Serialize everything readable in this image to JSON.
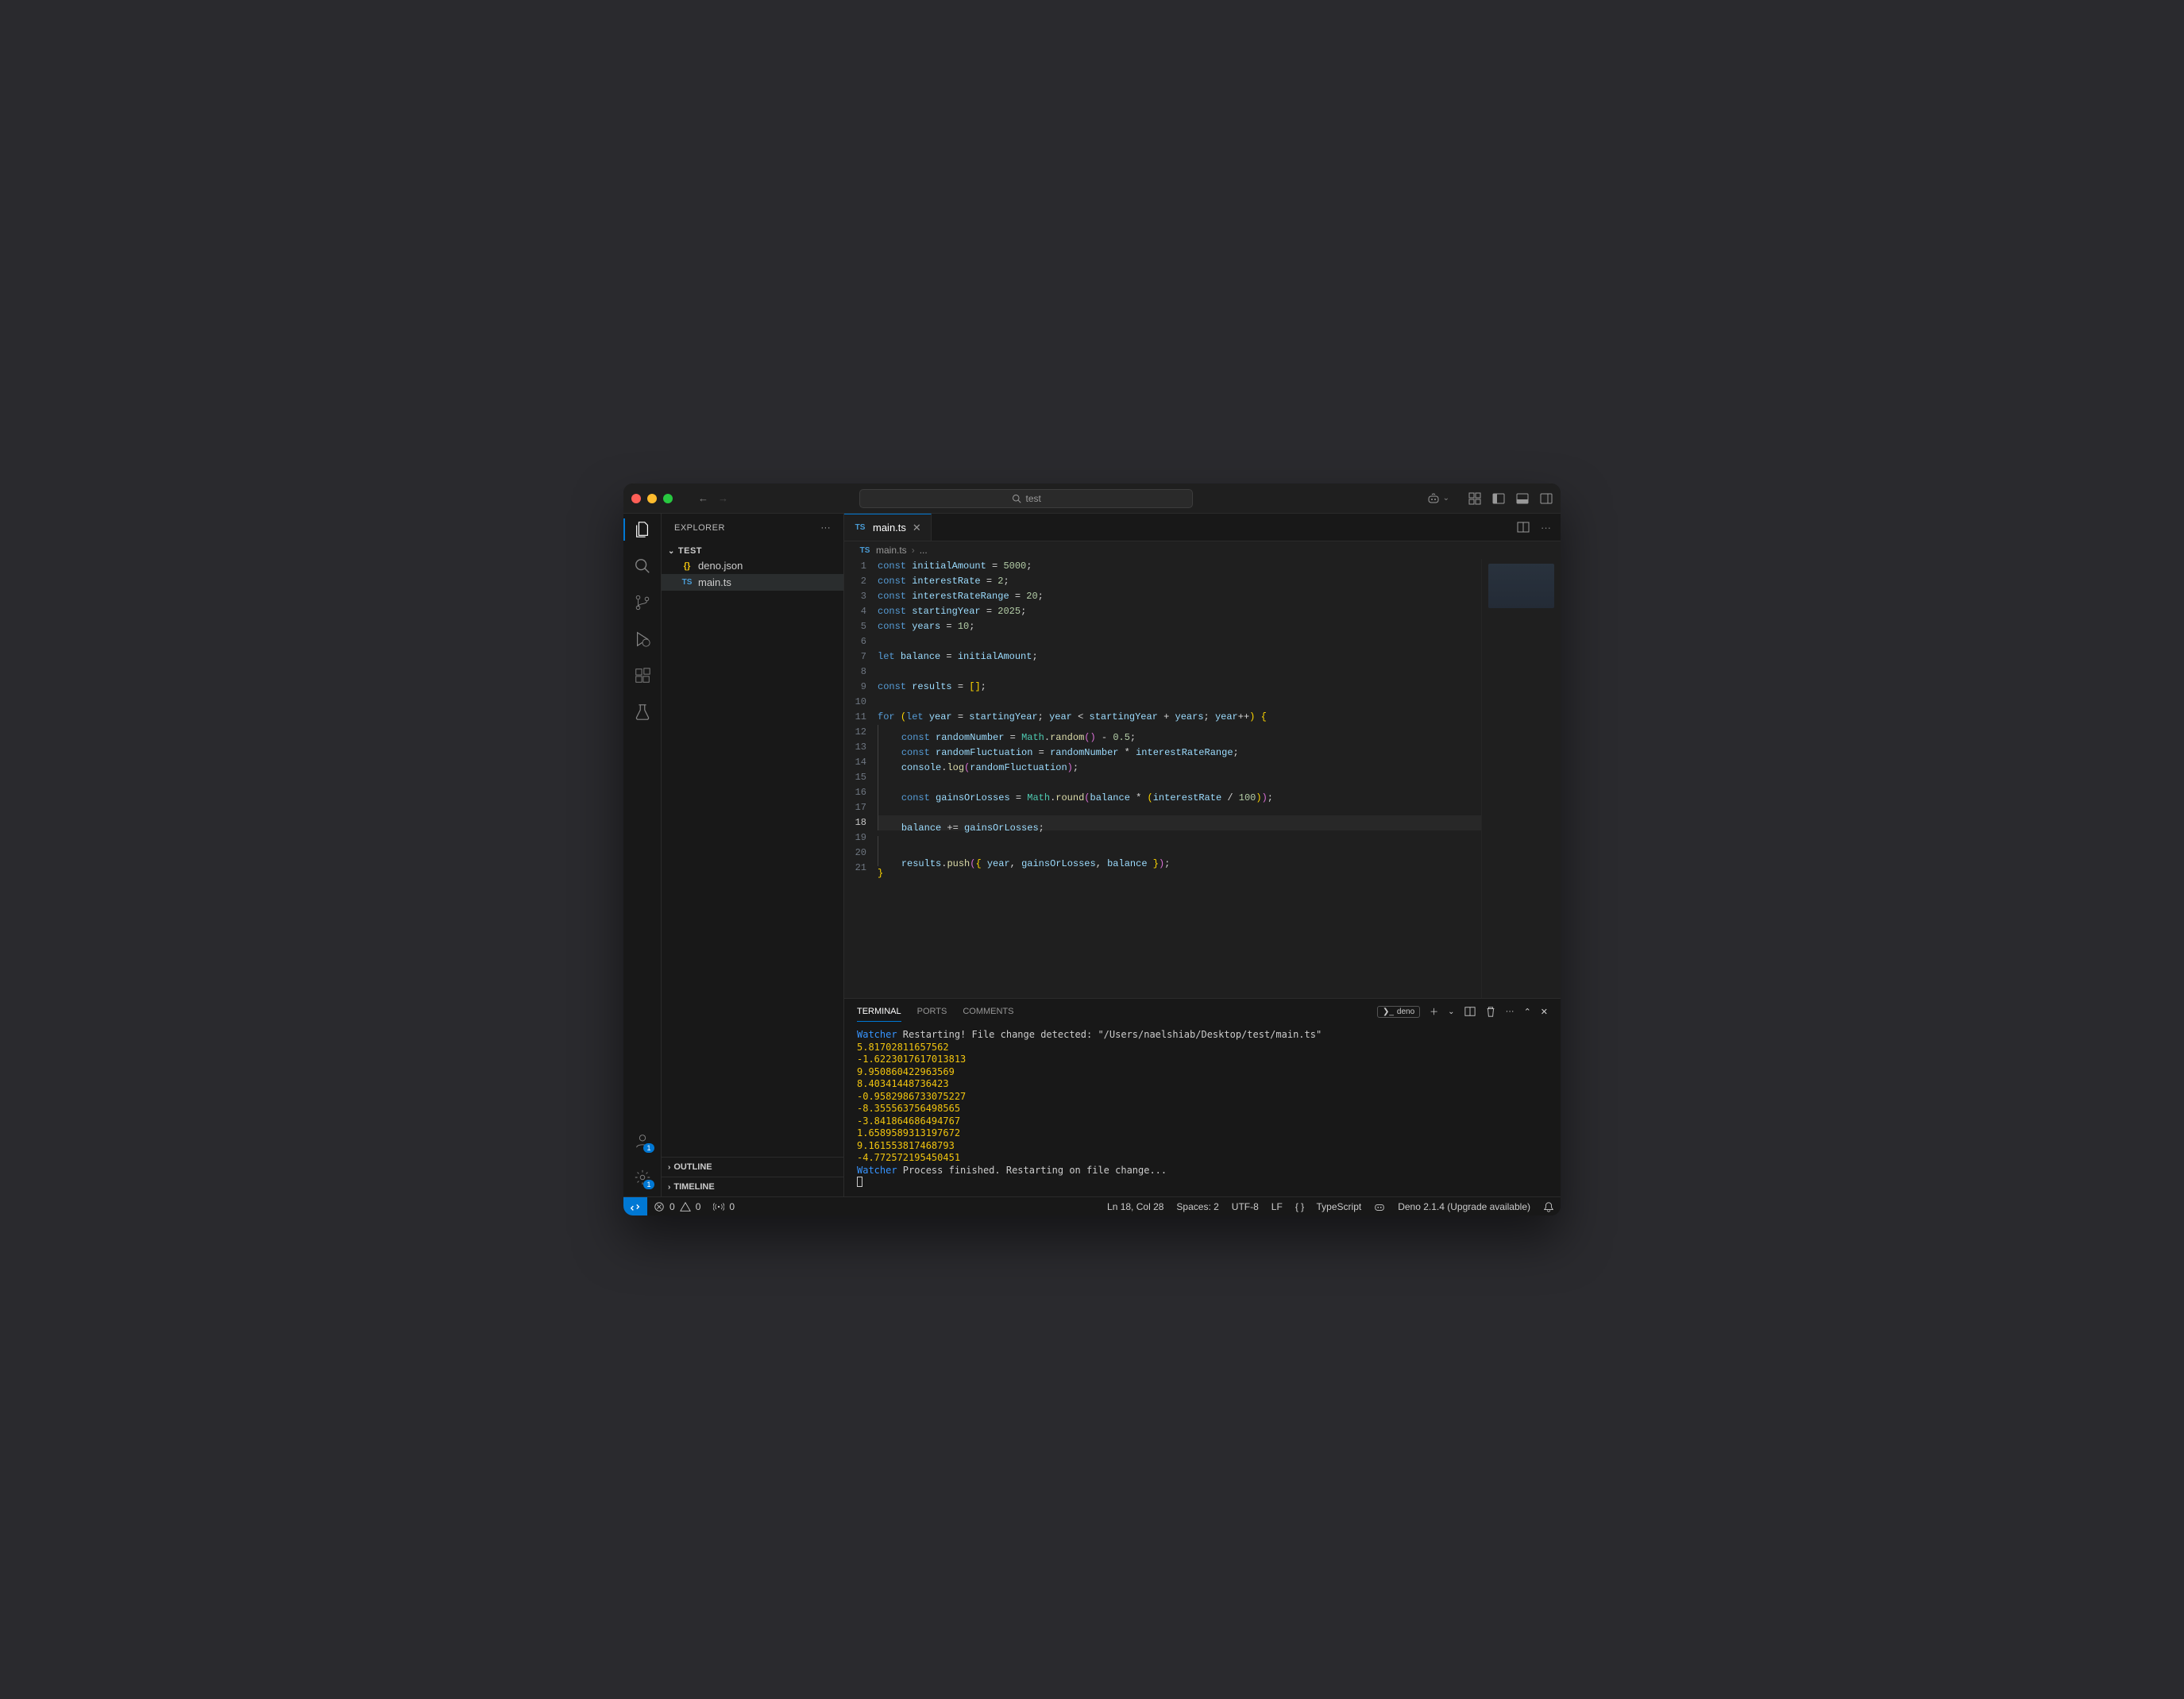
{
  "titlebar": {
    "search_text": "test"
  },
  "sidebar": {
    "title": "EXPLORER",
    "root": "TEST",
    "files": [
      {
        "icon": "{}",
        "icon_class": "json-icon",
        "name": "deno.json",
        "selected": false
      },
      {
        "icon": "TS",
        "icon_class": "ts-icon",
        "name": "main.ts",
        "selected": true
      }
    ],
    "outline": "OUTLINE",
    "timeline": "TIMELINE"
  },
  "activity": {
    "accounts_badge": "1",
    "settings_badge": "1"
  },
  "tab": {
    "icon": "TS",
    "label": "main.ts"
  },
  "breadcrumb": {
    "icon": "TS",
    "file": "main.ts",
    "rest": "..."
  },
  "code": {
    "current_line": 18,
    "lines": [
      [
        [
          "kw",
          "const "
        ],
        [
          "id",
          "initialAmount"
        ],
        [
          "op",
          " = "
        ],
        [
          "nm",
          "5000"
        ],
        [
          "op",
          ";"
        ]
      ],
      [
        [
          "kw",
          "const "
        ],
        [
          "id",
          "interestRate"
        ],
        [
          "op",
          " = "
        ],
        [
          "nm",
          "2"
        ],
        [
          "op",
          ";"
        ]
      ],
      [
        [
          "kw",
          "const "
        ],
        [
          "id",
          "interestRateRange"
        ],
        [
          "op",
          " = "
        ],
        [
          "nm",
          "20"
        ],
        [
          "op",
          ";"
        ]
      ],
      [
        [
          "kw",
          "const "
        ],
        [
          "id",
          "startingYear"
        ],
        [
          "op",
          " = "
        ],
        [
          "nm",
          "2025"
        ],
        [
          "op",
          ";"
        ]
      ],
      [
        [
          "kw",
          "const "
        ],
        [
          "id",
          "years"
        ],
        [
          "op",
          " = "
        ],
        [
          "nm",
          "10"
        ],
        [
          "op",
          ";"
        ]
      ],
      [],
      [
        [
          "kw",
          "let "
        ],
        [
          "id",
          "balance"
        ],
        [
          "op",
          " = "
        ],
        [
          "id",
          "initialAmount"
        ],
        [
          "op",
          ";"
        ]
      ],
      [],
      [
        [
          "kw",
          "const "
        ],
        [
          "id",
          "results"
        ],
        [
          "op",
          " = "
        ],
        [
          "br",
          "["
        ],
        [
          "br",
          "]"
        ],
        [
          "op",
          ";"
        ]
      ],
      [],
      [
        [
          "kw",
          "for "
        ],
        [
          "br",
          "("
        ],
        [
          "kw",
          "let "
        ],
        [
          "id",
          "year"
        ],
        [
          "op",
          " = "
        ],
        [
          "id",
          "startingYear"
        ],
        [
          "op",
          "; "
        ],
        [
          "id",
          "year"
        ],
        [
          "op",
          " < "
        ],
        [
          "id",
          "startingYear"
        ],
        [
          "op",
          " + "
        ],
        [
          "id",
          "years"
        ],
        [
          "op",
          "; "
        ],
        [
          "id",
          "year"
        ],
        [
          "op",
          "++"
        ],
        [
          "br",
          ") "
        ],
        [
          "br",
          "{"
        ]
      ],
      [
        [
          "op",
          "    "
        ],
        [
          "kw",
          "const "
        ],
        [
          "id",
          "randomNumber"
        ],
        [
          "op",
          " = "
        ],
        [
          "cl",
          "Math"
        ],
        [
          "op",
          "."
        ],
        [
          "fn",
          "random"
        ],
        [
          "br2",
          "("
        ],
        [
          "br2",
          ")"
        ],
        [
          "op",
          " - "
        ],
        [
          "nm",
          "0.5"
        ],
        [
          "op",
          ";"
        ]
      ],
      [
        [
          "op",
          "    "
        ],
        [
          "kw",
          "const "
        ],
        [
          "id",
          "randomFluctuation"
        ],
        [
          "op",
          " = "
        ],
        [
          "id",
          "randomNumber"
        ],
        [
          "op",
          " * "
        ],
        [
          "id",
          "interestRateRange"
        ],
        [
          "op",
          ";"
        ]
      ],
      [
        [
          "op",
          "    "
        ],
        [
          "id",
          "console"
        ],
        [
          "op",
          "."
        ],
        [
          "fn",
          "log"
        ],
        [
          "br2",
          "("
        ],
        [
          "id",
          "randomFluctuation"
        ],
        [
          "br2",
          ")"
        ],
        [
          "op",
          ";"
        ]
      ],
      [],
      [
        [
          "op",
          "    "
        ],
        [
          "kw",
          "const "
        ],
        [
          "id",
          "gainsOrLosses"
        ],
        [
          "op",
          " = "
        ],
        [
          "cl",
          "Math"
        ],
        [
          "op",
          "."
        ],
        [
          "fn",
          "round"
        ],
        [
          "br2",
          "("
        ],
        [
          "id",
          "balance"
        ],
        [
          "op",
          " * "
        ],
        [
          "br",
          "("
        ],
        [
          "id",
          "interestRate"
        ],
        [
          "op",
          " / "
        ],
        [
          "nm",
          "100"
        ],
        [
          "br",
          ")"
        ],
        [
          "br2",
          ")"
        ],
        [
          "op",
          ";"
        ]
      ],
      [],
      [
        [
          "op",
          "    "
        ],
        [
          "id",
          "balance"
        ],
        [
          "op",
          " += "
        ],
        [
          "id",
          "gainsOrLosses"
        ],
        [
          "op",
          ";"
        ]
      ],
      [],
      [
        [
          "op",
          "    "
        ],
        [
          "id",
          "results"
        ],
        [
          "op",
          "."
        ],
        [
          "fn",
          "push"
        ],
        [
          "br2",
          "("
        ],
        [
          "br",
          "{"
        ],
        [
          "op",
          " "
        ],
        [
          "id",
          "year"
        ],
        [
          "op",
          ", "
        ],
        [
          "id",
          "gainsOrLosses"
        ],
        [
          "op",
          ", "
        ],
        [
          "id",
          "balance"
        ],
        [
          "op",
          " "
        ],
        [
          "br",
          "}"
        ],
        [
          "br2",
          ")"
        ],
        [
          "op",
          ";"
        ]
      ],
      [
        [
          "br",
          "}"
        ]
      ]
    ]
  },
  "panel": {
    "tabs": {
      "terminal": "TERMINAL",
      "ports": "PORTS",
      "comments": "COMMENTS"
    },
    "shell": "deno",
    "output": [
      {
        "prefix": "Watcher",
        "text": " Restarting! File change detected: \"/Users/naelshiab/Desktop/test/main.ts\"",
        "prefix_cls": "t-blue",
        "text_cls": ""
      },
      {
        "text": "5.81702811657562",
        "text_cls": "t-yel"
      },
      {
        "text": "-1.6223017617013813",
        "text_cls": "t-yel"
      },
      {
        "text": "9.950860422963569",
        "text_cls": "t-yel"
      },
      {
        "text": "8.40341448736423",
        "text_cls": "t-yel"
      },
      {
        "text": "-0.9582986733075227",
        "text_cls": "t-yel"
      },
      {
        "text": "-8.355563756498565",
        "text_cls": "t-yel"
      },
      {
        "text": "-3.841864686494767",
        "text_cls": "t-yel"
      },
      {
        "text": "1.6589589313197672",
        "text_cls": "t-yel"
      },
      {
        "text": "9.161553817468793",
        "text_cls": "t-yel"
      },
      {
        "text": "-4.772572195450451",
        "text_cls": "t-yel"
      },
      {
        "prefix": "Watcher",
        "text": " Process finished. Restarting on file change...",
        "prefix_cls": "t-blue",
        "text_cls": ""
      }
    ]
  },
  "status": {
    "errors": "0",
    "warnings": "0",
    "ports": "0",
    "pos": "Ln 18, Col 28",
    "spaces": "Spaces: 2",
    "encoding": "UTF-8",
    "eol": "LF",
    "lang": "TypeScript",
    "runtime": "Deno 2.1.4 (Upgrade available)"
  }
}
